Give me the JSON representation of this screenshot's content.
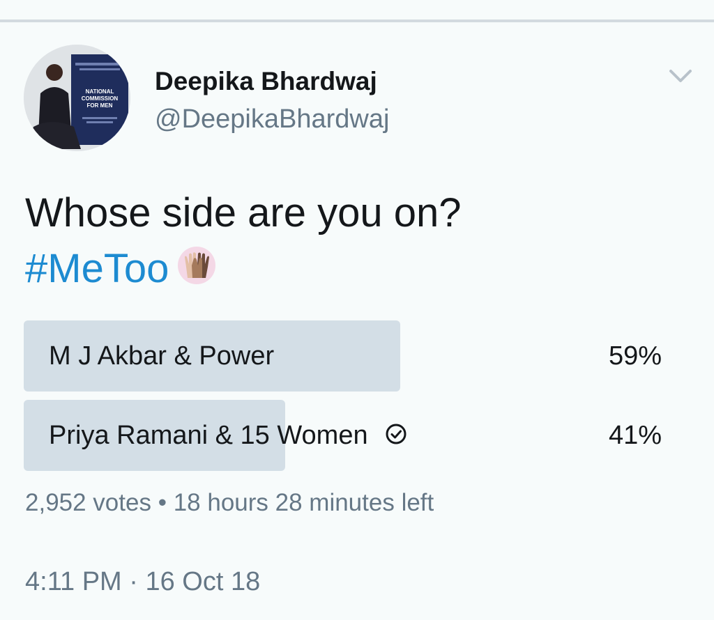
{
  "author": {
    "name": "Deepika Bhardwaj",
    "handle": "@DeepikaBhardwaj",
    "avatar_text": [
      "NATIONAL",
      "COMMISSION",
      "FOR MEN"
    ]
  },
  "tweet": {
    "text": "Whose side are you on?",
    "hashtag": "#MeToo",
    "emoji": "raised-hands-emoji"
  },
  "poll": {
    "options": [
      {
        "label": "M J Akbar & Power",
        "percent": "59%",
        "value": 59,
        "selected": false
      },
      {
        "label": "Priya Ramani & 15 Women",
        "percent": "41%",
        "value": 41,
        "selected": true
      }
    ],
    "votes": "2,952 votes",
    "separator": "•",
    "time_left": "18 hours 28 minutes left"
  },
  "timestamp": "4:11 PM · 16 Oct 18",
  "colors": {
    "background": "#f7fbfb",
    "hashtag": "#1d8bd1",
    "poll_bar": "#d3dee6",
    "secondary_text": "#657786",
    "primary_text": "#14171a"
  }
}
